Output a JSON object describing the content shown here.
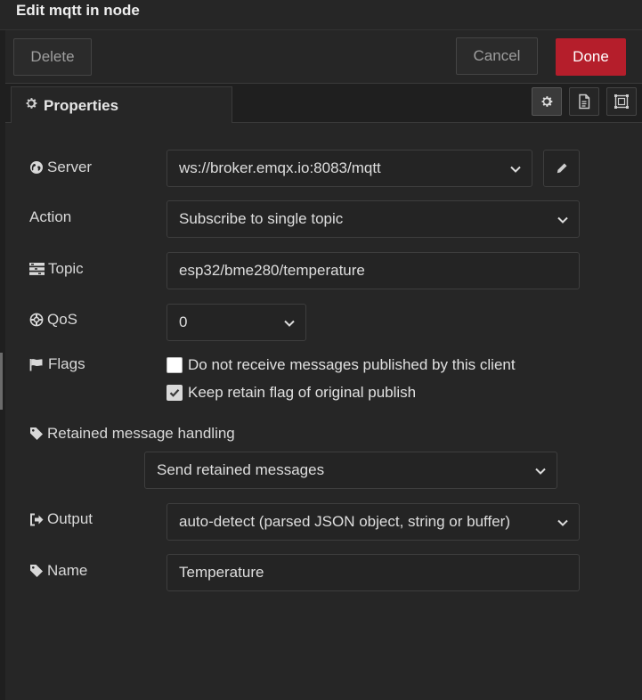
{
  "dialog": {
    "title": "Edit mqtt in node"
  },
  "toolbar": {
    "delete_label": "Delete",
    "cancel_label": "Cancel",
    "done_label": "Done"
  },
  "tabs": {
    "properties_label": "Properties"
  },
  "form": {
    "server": {
      "label": "Server",
      "value": "ws://broker.emqx.io:8083/mqtt"
    },
    "action": {
      "label": "Action",
      "value": "Subscribe to single topic"
    },
    "topic": {
      "label": "Topic",
      "value": "esp32/bme280/temperature"
    },
    "qos": {
      "label": "QoS",
      "value": "0"
    },
    "flags": {
      "label": "Flags",
      "no_local": {
        "label": "Do not receive messages published by this client",
        "checked": false
      },
      "retain_as_published": {
        "label": "Keep retain flag of original publish",
        "checked": true
      }
    },
    "retained": {
      "label": "Retained message handling",
      "value": "Send retained messages"
    },
    "output": {
      "label": "Output",
      "value": "auto-detect (parsed JSON object, string or buffer)"
    },
    "name": {
      "label": "Name",
      "value": "Temperature"
    }
  },
  "colors": {
    "done_button": "#b51e2b",
    "background": "#262626"
  }
}
